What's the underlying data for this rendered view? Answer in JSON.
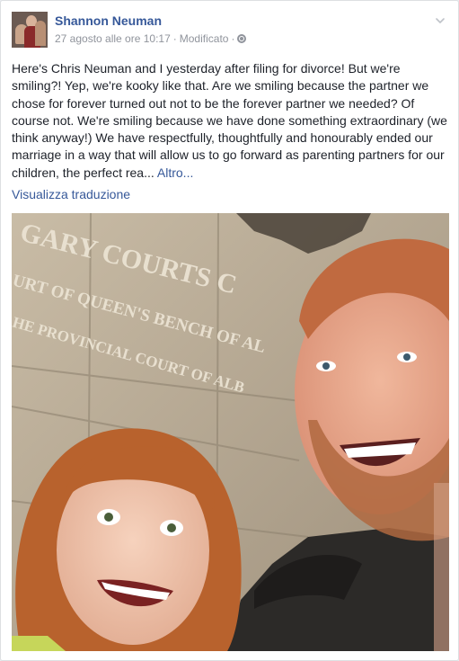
{
  "post": {
    "author": "Shannon Neuman",
    "timestamp": "27 agosto alle ore 10:17",
    "edited_label": "Modificato",
    "separator": "·",
    "privacy_icon": "globe-icon",
    "menu_icon": "chevron-down-icon",
    "body": "Here's Chris Neuman and I yesterday after filing for divorce! But we're smiling?! Yep, we're kooky like that. Are we smiling because the partner we chose for forever turned out not to be the forever partner we needed? Of course not. We're smiling because we have done something extraordinary (we think anyway!) We have respectfully, thoughtfully and honourably ended our marriage in a way that will allow us to go forward as parenting partners for our children, the perfect rea...",
    "more_link": "Altro...",
    "translate_link": "Visualizza traduzione"
  },
  "photo": {
    "sign_line_1": "GARY COURTS C",
    "sign_line_2": "URT OF QUEEN'S BENCH OF AL",
    "sign_line_3": "HE PROVINCIAL COURT OF ALB"
  }
}
